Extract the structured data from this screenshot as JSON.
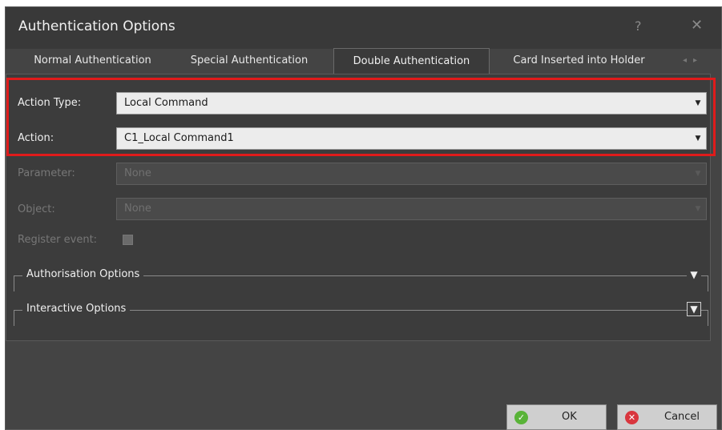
{
  "dialog": {
    "title": "Authentication Options",
    "help_label": "?",
    "close_label": "✕"
  },
  "tabs": [
    {
      "label": "Normal Authentication",
      "active": false
    },
    {
      "label": "Special Authentication",
      "active": false
    },
    {
      "label": "Double Authentication",
      "active": true
    },
    {
      "label": "Card Inserted into Holder",
      "active": false
    }
  ],
  "tab_scroll": {
    "left": "◂",
    "right": "▸"
  },
  "form": {
    "action_type": {
      "label": "Action Type:",
      "value": "Local Command"
    },
    "action": {
      "label": "Action:",
      "value": "C1_Local Command1"
    },
    "parameter": {
      "label": "Parameter:",
      "value": "None"
    },
    "object": {
      "label": "Object:",
      "value": "None"
    },
    "register_event": {
      "label": "Register event:",
      "checked": false
    }
  },
  "groups": {
    "authorisation": {
      "title": "Authorisation Options"
    },
    "interactive": {
      "title": "Interactive Options"
    }
  },
  "buttons": {
    "ok": "OK",
    "cancel": "Cancel"
  },
  "colors": {
    "highlight": "#e01b1b",
    "ok_icon": "#59b338",
    "cancel_icon": "#d9363e"
  }
}
